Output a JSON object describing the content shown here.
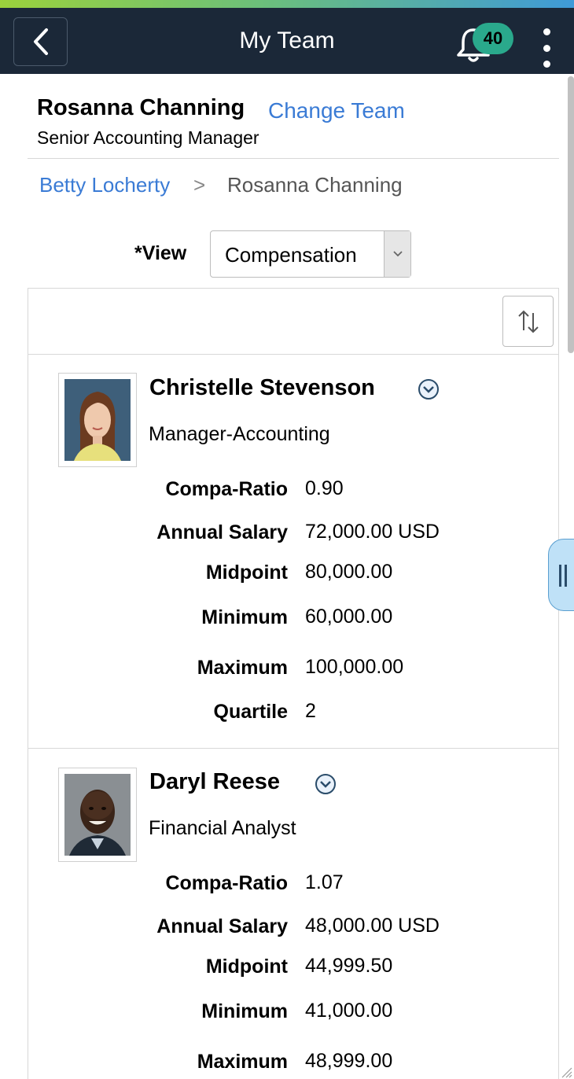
{
  "header": {
    "title": "My Team",
    "notification_count": "40",
    "accent_colors": [
      "#9bd23c",
      "#3f9ad8"
    ],
    "background": "#1b2838"
  },
  "team_owner": {
    "name": "Rosanna Channing",
    "change_team_label": "Change Team",
    "job_title": "Senior Accounting Manager"
  },
  "breadcrumb": {
    "parent": "Betty Locherty",
    "separator": ">",
    "current": "Rosanna Channing"
  },
  "view": {
    "label": "*View",
    "selected": "Compensation"
  },
  "employees": [
    {
      "name": "Christelle Stevenson",
      "job": "Manager-Accounting",
      "fields": [
        {
          "label": "Compa-Ratio",
          "value": "0.90"
        },
        {
          "label": "Annual Salary",
          "value": "72,000.00  USD"
        },
        {
          "label": "Midpoint",
          "value": "80,000.00"
        },
        {
          "label": "Minimum",
          "value": "60,000.00"
        },
        {
          "label": "Maximum",
          "value": "100,000.00"
        },
        {
          "label": "Quartile",
          "value": "2"
        }
      ]
    },
    {
      "name": "Daryl Reese",
      "job": "Financial Analyst",
      "fields": [
        {
          "label": "Compa-Ratio",
          "value": "1.07"
        },
        {
          "label": "Annual Salary",
          "value": "48,000.00  USD"
        },
        {
          "label": "Midpoint",
          "value": "44,999.50"
        },
        {
          "label": "Minimum",
          "value": "41,000.00"
        },
        {
          "label": "Maximum",
          "value": "48,999.00"
        }
      ]
    }
  ],
  "icons": {
    "back": "chevron-left-icon",
    "notifications": "bell-icon",
    "actions": "kebab-menu-icon",
    "sort": "sort-icon",
    "row_actions": "chevron-down-circle-icon",
    "side_panel": "panel-handle-icon"
  }
}
